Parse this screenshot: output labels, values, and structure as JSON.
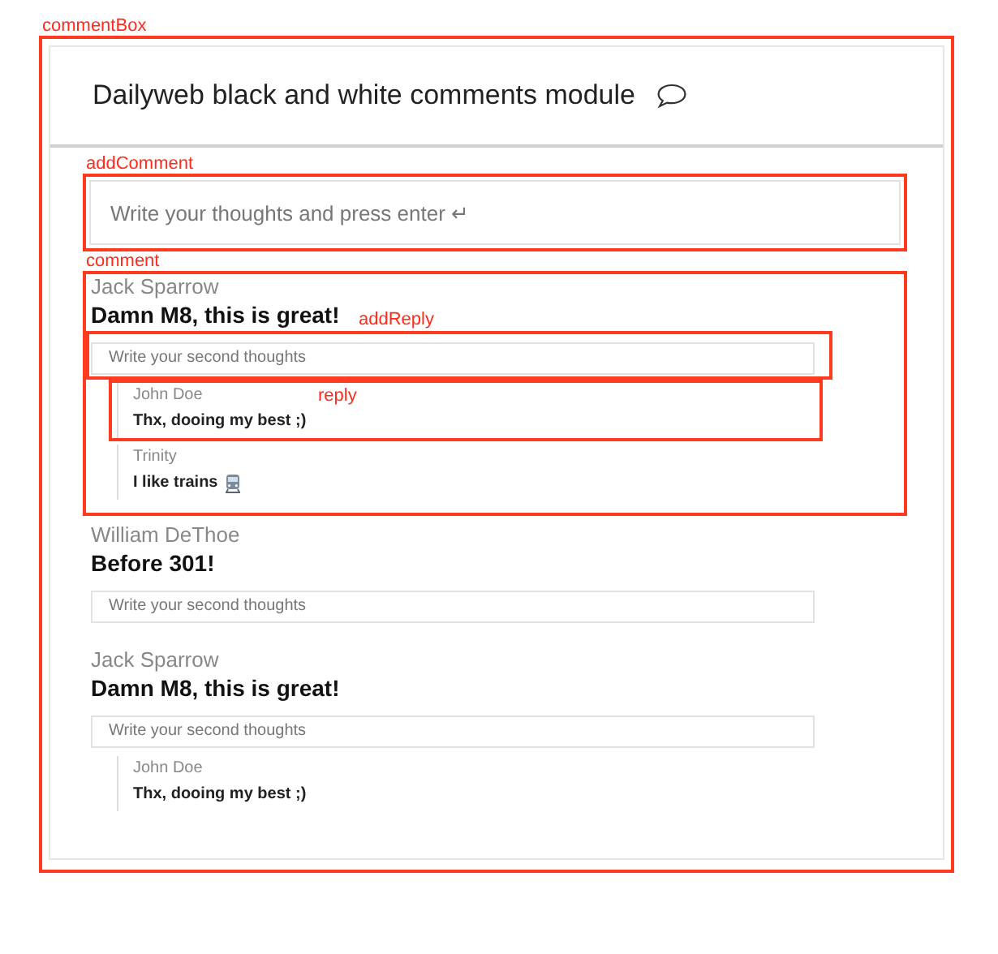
{
  "comment_box": {
    "annotation": {
      "label": "commentBox"
    },
    "title": "Dailyweb black and white comments module",
    "add_comment": {
      "placeholder": "Write your thoughts and press enter ↵",
      "annotation": {
        "label": "addComment"
      }
    },
    "comments": [
      {
        "author": "Jack Sparrow",
        "text": "Damn M8, this is great!",
        "annotation": {
          "label": "comment"
        },
        "add_reply": {
          "placeholder": "Write your second thoughts",
          "annotation": {
            "label": "addReply"
          }
        },
        "replies": [
          {
            "kind": "plain",
            "author": "John Doe",
            "text": "Thx, dooing my best ;)",
            "annotation": {
              "label": "reply"
            }
          },
          {
            "kind": "emoji",
            "author": "Trinity",
            "text": "I like trains"
          }
        ]
      },
      {
        "author": "William DeThoe",
        "text": "Before 301!",
        "add_reply": {
          "placeholder": "Write your second thoughts"
        }
      },
      {
        "author": "Jack Sparrow",
        "text": "Damn M8, this is great!",
        "add_reply": {
          "placeholder": "Write your second thoughts"
        },
        "replies": [
          {
            "kind": "plain",
            "author": "John Doe",
            "text": "Thx, dooing my best ;)"
          }
        ]
      }
    ]
  }
}
